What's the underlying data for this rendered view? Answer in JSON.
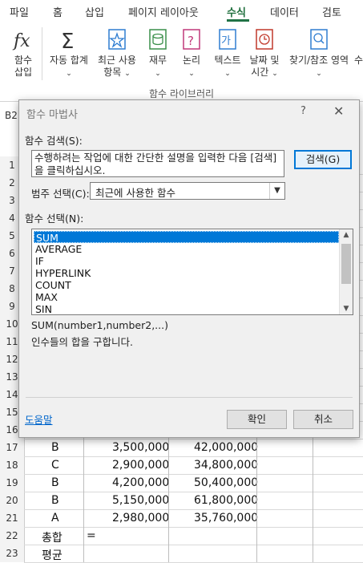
{
  "ribbon_tabs": [
    "파일",
    "홈",
    "삽입",
    "페이지 레이아웃",
    "수식",
    "데이터",
    "검토"
  ],
  "ribbon_buttons": {
    "insert_function": [
      "함수",
      "삽입"
    ],
    "autosum": "자동 합계",
    "recent": "최근 사용",
    "recent2": "항목",
    "financial": "재무",
    "logical": "논리",
    "text": "텍스트",
    "datetime": "날짜 및",
    "datetime2": "시간",
    "lookup": "찾기/참조 영역",
    "more": "수"
  },
  "group_label": "함수 라이브러리",
  "namebox": "B2",
  "rows": [
    {
      "num": "1"
    },
    {
      "num": "2"
    },
    {
      "num": "3"
    },
    {
      "num": "4"
    },
    {
      "num": "5"
    },
    {
      "num": "6"
    },
    {
      "num": "7"
    },
    {
      "num": "8"
    },
    {
      "num": "9"
    },
    {
      "num": "10"
    },
    {
      "num": "11"
    },
    {
      "num": "12"
    },
    {
      "num": "13"
    },
    {
      "num": "14"
    },
    {
      "num": "15"
    },
    {
      "num": "16"
    }
  ],
  "data_rows": [
    {
      "num": "17",
      "grade": "B",
      "amount": "3,500,000",
      "total": "42,000,000"
    },
    {
      "num": "18",
      "grade": "C",
      "amount": "2,900,000",
      "total": "34,800,000"
    },
    {
      "num": "19",
      "grade": "B",
      "amount": "4,200,000",
      "total": "50,400,000"
    },
    {
      "num": "20",
      "grade": "B",
      "amount": "5,150,000",
      "total": "61,800,000"
    },
    {
      "num": "21",
      "grade": "A",
      "amount": "2,980,000",
      "total": "35,760,000"
    }
  ],
  "summary_rows": [
    {
      "num": "22",
      "label": "총합",
      "value": "="
    },
    {
      "num": "23",
      "label": "평균",
      "value": ""
    }
  ],
  "dialog": {
    "title": "함수 마법사",
    "help": "?",
    "close": "✕",
    "search_label": "함수 검색(S):",
    "search_desc": "수행하려는 작업에 대한 간단한 설명을 입력한 다음 [검색]을 클릭하십시오.",
    "search_button": "검색(G)",
    "category_label": "범주 선택(C):",
    "category_value": "최근에 사용한 함수",
    "function_label": "함수 선택(N):",
    "functions": [
      "SUM",
      "AVERAGE",
      "IF",
      "HYPERLINK",
      "COUNT",
      "MAX",
      "SIN"
    ],
    "selected_function": "SUM",
    "syntax": "SUM(number1,number2,...)",
    "description": "인수들의 합을 구합니다.",
    "help_link": "도움말",
    "ok_button": "확인",
    "cancel_button": "취소"
  },
  "accent_color": "#217346",
  "selection_color": "#0078d7"
}
